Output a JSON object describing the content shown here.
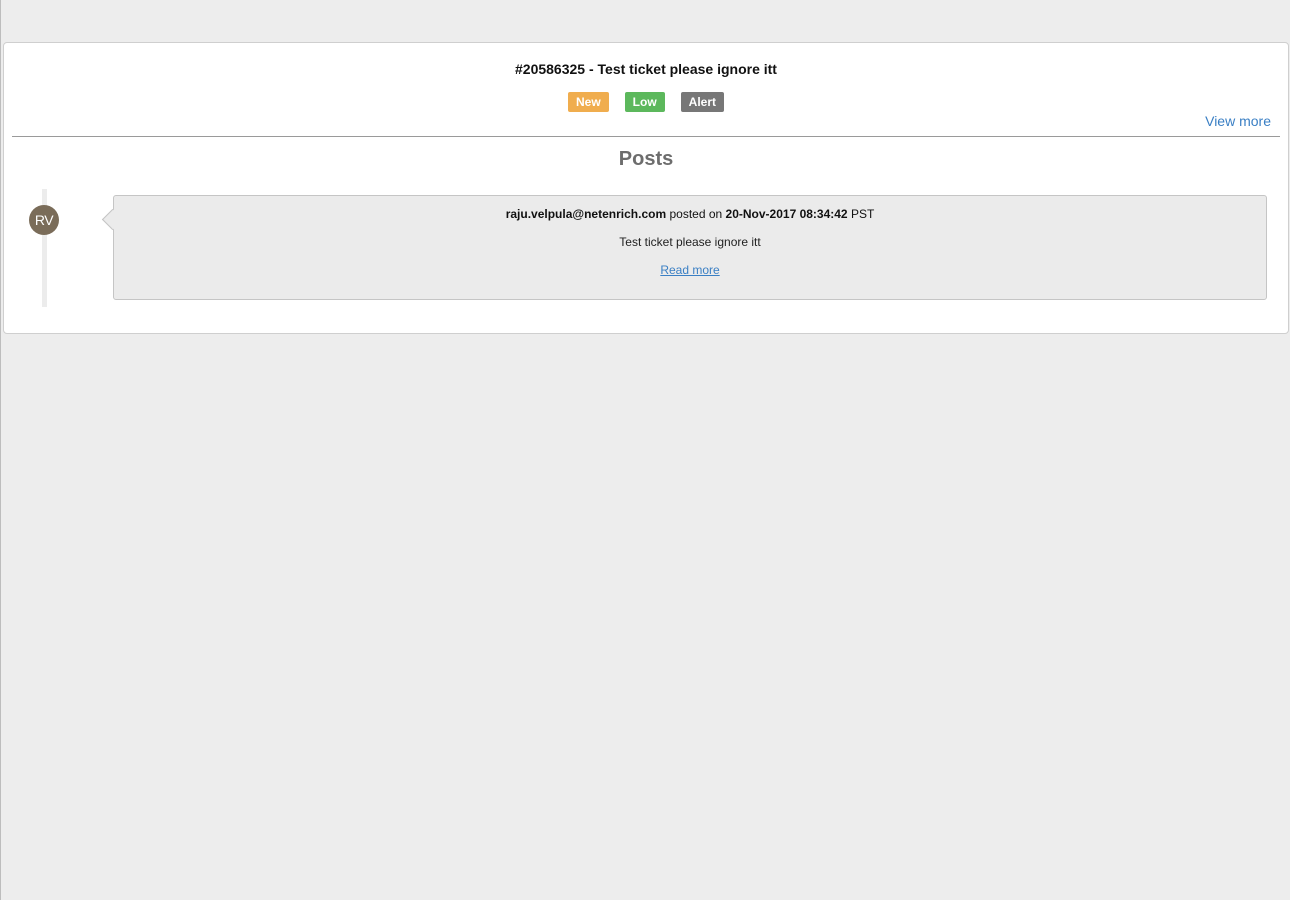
{
  "ticket": {
    "title": "#20586325 -  Test ticket please ignore itt",
    "badges": [
      {
        "label": "New",
        "color": "#f0ad4e"
      },
      {
        "label": "Low",
        "color": "#5cb85c"
      },
      {
        "label": "Alert",
        "color": "#777777"
      }
    ],
    "view_more_label": "View more"
  },
  "posts": {
    "heading": "Posts",
    "items": [
      {
        "avatar_initials": "RV",
        "author": "raju.velpula@netenrich.com",
        "posted_on_label": "posted on",
        "timestamp": "20-Nov-2017 08:34:42",
        "timezone": "PST",
        "body": "Test ticket please ignore itt",
        "read_more_label": "Read more"
      }
    ]
  }
}
